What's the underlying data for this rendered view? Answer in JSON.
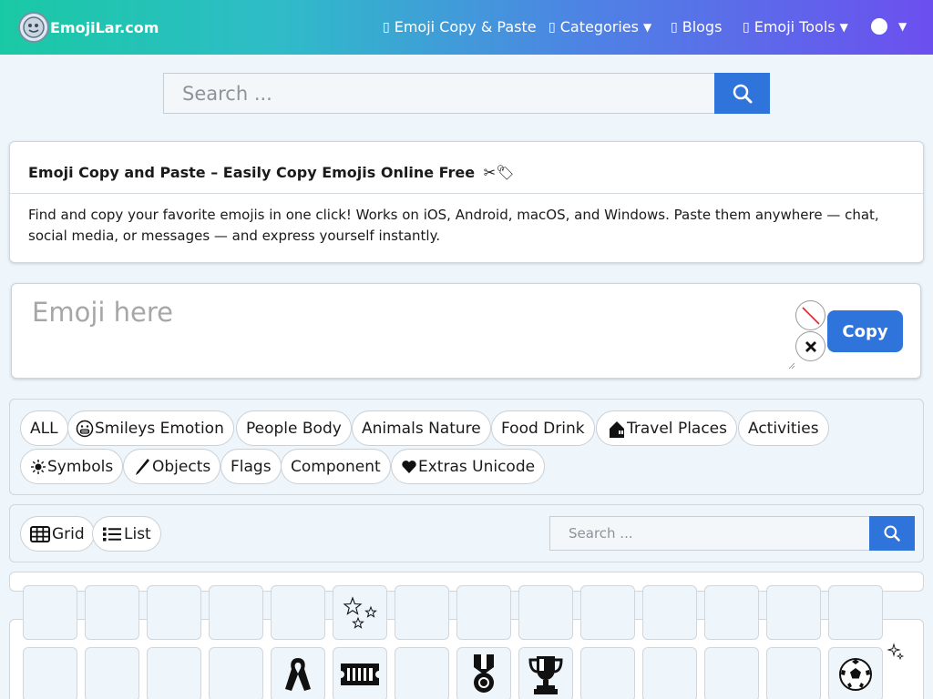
{
  "navbar": {
    "brand": "EmojiLar.com",
    "links": [
      {
        "label": "Emoji Copy & Paste",
        "has_dropdown": false
      },
      {
        "label": "Categories",
        "has_dropdown": true
      },
      {
        "label": "Blogs",
        "has_dropdown": false
      },
      {
        "label": "Emoji Tools",
        "has_dropdown": true
      }
    ],
    "tofu_glyph": "▯",
    "dropdown_caret": "▼"
  },
  "top_search": {
    "placeholder": "Search ..."
  },
  "intro": {
    "title": "Emoji Copy and Paste – Easily Copy Emojis Online Free",
    "title_icon": "✂🏷",
    "text": "Find and copy your favorite emojis in one click! Works on iOS, Android, macOS, and Windows. Paste them anywhere — chat, social media, or messages — and express yourself instantly."
  },
  "emoji_box": {
    "placeholder": "Emoji here",
    "copy_label": "Copy"
  },
  "categories": [
    {
      "label": "ALL",
      "icon": ""
    },
    {
      "label": "Smileys Emotion",
      "icon": "grin-icon"
    },
    {
      "label": "People Body",
      "icon": ""
    },
    {
      "label": "Animals Nature",
      "icon": ""
    },
    {
      "label": "Food Drink",
      "icon": ""
    },
    {
      "label": "Travel Places",
      "icon": "house-icon"
    },
    {
      "label": "Activities",
      "icon": ""
    },
    {
      "label": "Symbols",
      "icon": "sun-icon"
    },
    {
      "label": "Objects",
      "icon": "pen-icon"
    },
    {
      "label": "Flags",
      "icon": ""
    },
    {
      "label": "Component",
      "icon": ""
    },
    {
      "label": "Extras Unicode",
      "icon": "heart-icon"
    }
  ],
  "view": {
    "grid_label": "Grid",
    "list_label": "List",
    "search_placeholder": "Search ..."
  },
  "emoji_grid": {
    "row1": [
      "",
      "",
      "",
      "",
      "",
      "stars-icon",
      "",
      "",
      "",
      "",
      "",
      "",
      "",
      ""
    ],
    "row2": [
      "",
      "",
      "",
      "",
      "ribbon-icon",
      "ticket-icon",
      "",
      "medal-icon",
      "trophy-icon",
      "",
      "",
      "",
      "",
      "soccer-ball-icon"
    ]
  },
  "colors": {
    "accent_blue": "#2f74db",
    "nav_gradient_start": "#19c9a4",
    "nav_gradient_end": "#6c4fef",
    "page_bg": "#eef5fb"
  }
}
